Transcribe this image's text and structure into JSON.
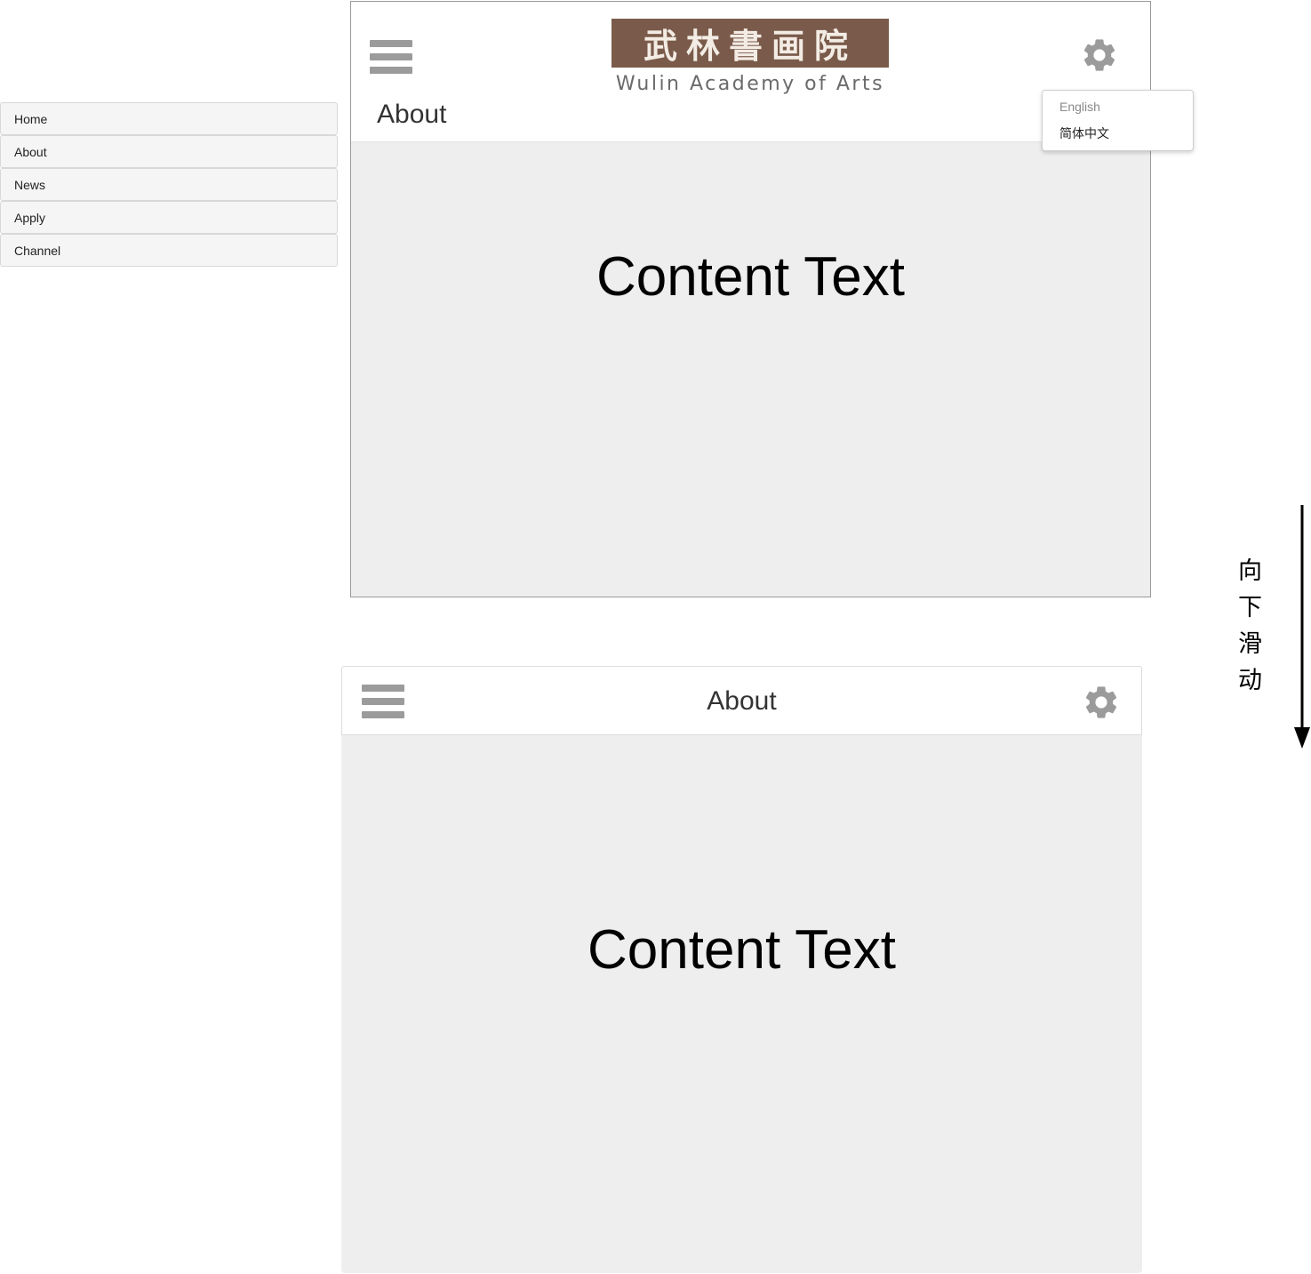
{
  "side_menu": {
    "items": [
      {
        "label": "Home"
      },
      {
        "label": "About"
      },
      {
        "label": "News"
      },
      {
        "label": "Apply"
      },
      {
        "label": "Channel"
      }
    ]
  },
  "frame_top": {
    "logo": {
      "chinese": "武林書画院",
      "english": "Wulin Academy of Arts"
    },
    "page_title": "About",
    "content_text": "Content Text"
  },
  "language_menu": {
    "options": [
      {
        "label": "English"
      },
      {
        "label": "简体中文"
      }
    ]
  },
  "frame_bottom": {
    "page_title": "About",
    "content_text": "Content Text"
  },
  "scroll_annotation": {
    "chars": [
      "向",
      "下",
      "滑",
      "动"
    ]
  },
  "colors": {
    "icon_gray": "#9b9b9b",
    "content_bg": "#eeeeee",
    "logo_bg": "#7a5a4a"
  },
  "icons": {
    "menu": "hamburger-menu-icon",
    "settings": "gear-icon",
    "arrow": "down-arrow-icon"
  }
}
